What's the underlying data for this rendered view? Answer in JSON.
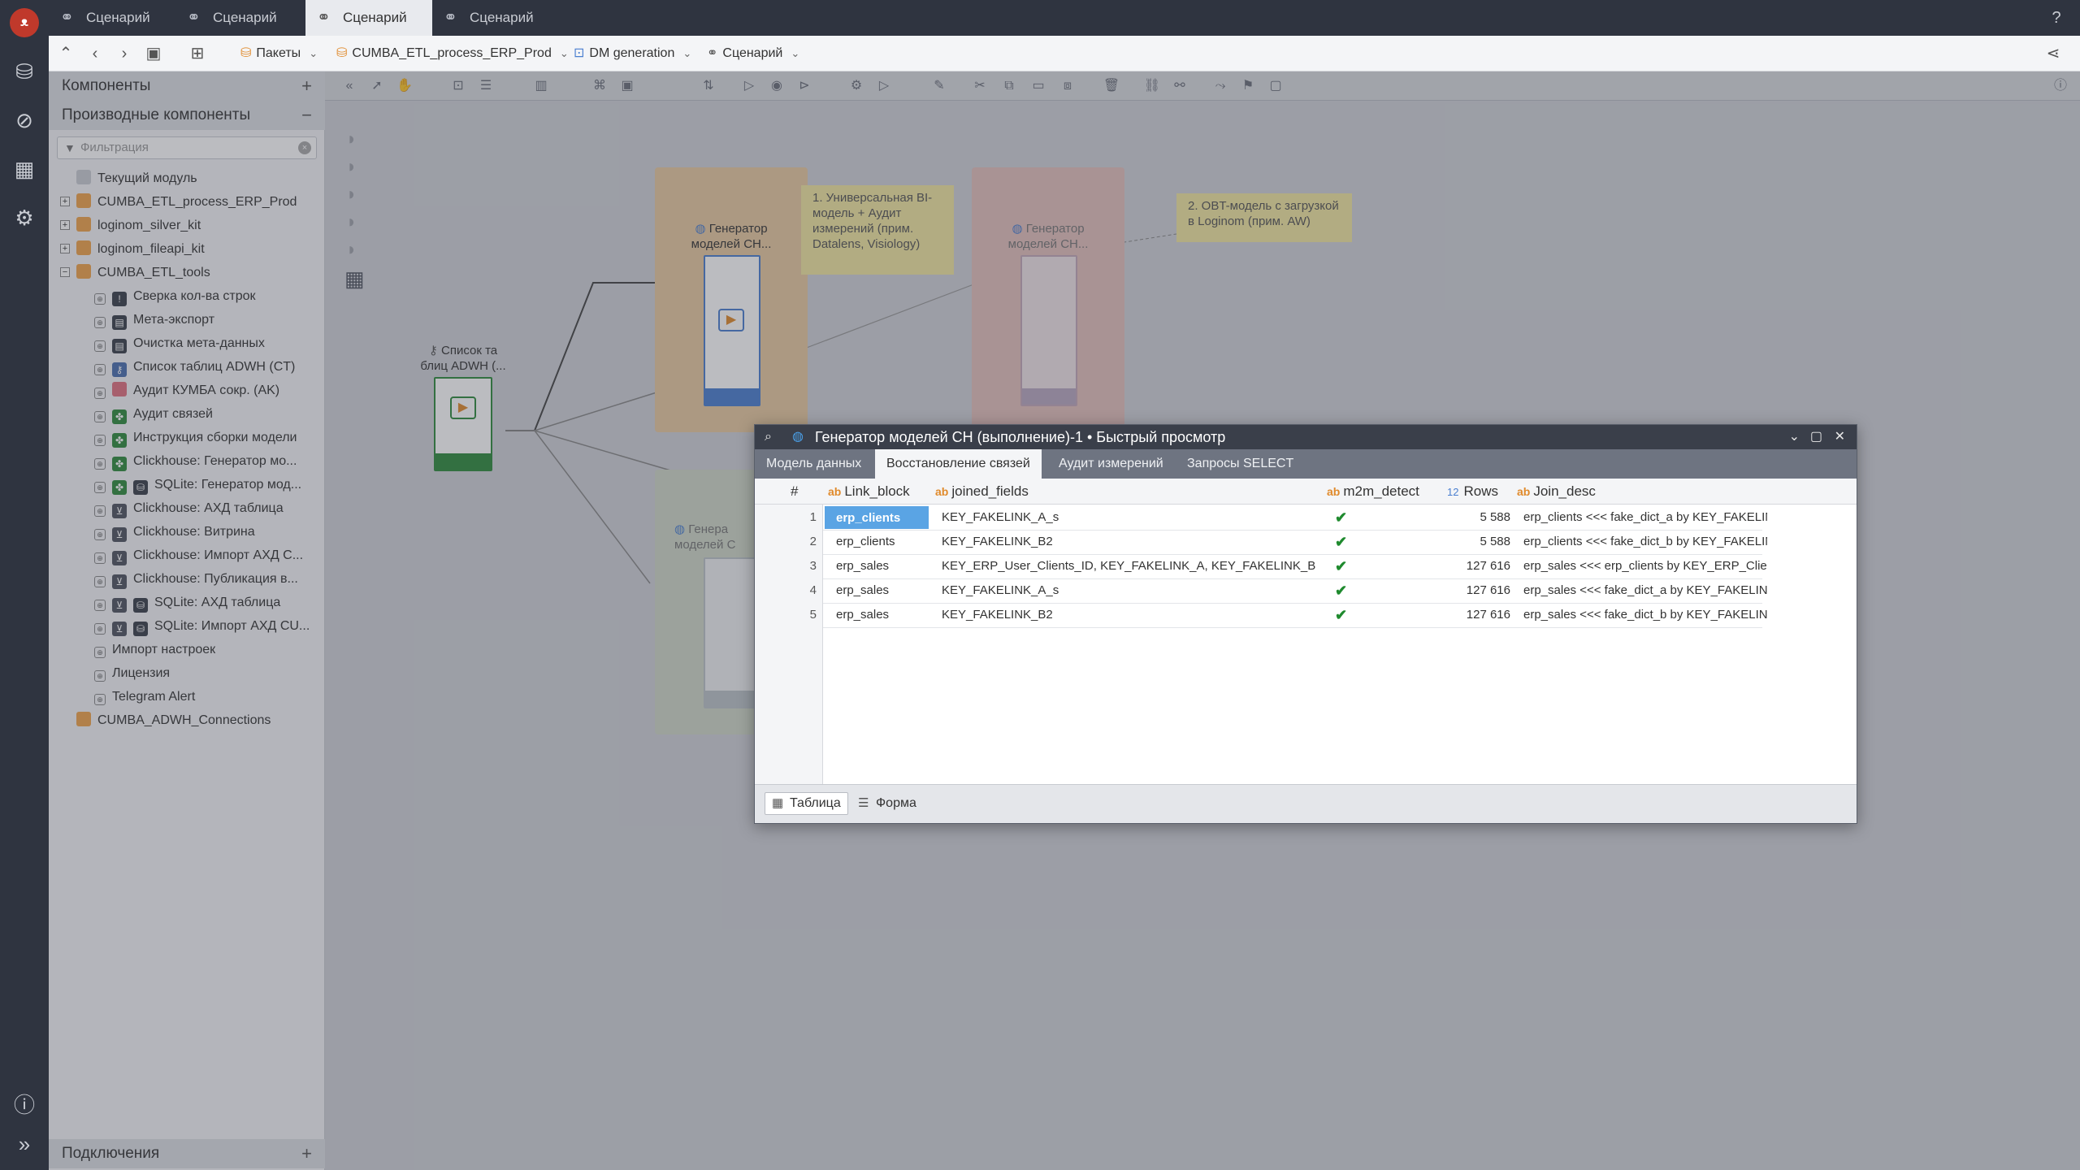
{
  "tabs": [
    {
      "label": "Сценарий"
    },
    {
      "label": "Сценарий"
    },
    {
      "label": "Сценарий"
    },
    {
      "label": "Сценарий"
    }
  ],
  "breadcrumbs": [
    {
      "label": "Пакеты"
    },
    {
      "label": "CUMBA_ETL_process_ERP_Prod"
    },
    {
      "label": "DM generation"
    },
    {
      "label": "Сценарий"
    }
  ],
  "left_panel": {
    "components_title": "Компоненты",
    "derived_title": "Производные компоненты",
    "filter_placeholder": "Фильтрация",
    "connections_title": "Подключения",
    "tree": [
      {
        "label": "Текущий модуль"
      },
      {
        "label": "CUMBA_ETL_process_ERP_Prod"
      },
      {
        "label": "loginom_silver_kit"
      },
      {
        "label": "loginom_fileapi_kit"
      },
      {
        "label": "CUMBA_ETL_tools"
      },
      {
        "label": "Сверка кол-ва строк"
      },
      {
        "label": "Мета-экспорт"
      },
      {
        "label": "Очистка мета-данных"
      },
      {
        "label": "Список таблиц ADWH (CT)"
      },
      {
        "label": "Аудит КУМБА сокр. (AK)"
      },
      {
        "label": "Аудит связей"
      },
      {
        "label": "Инструкция сборки модели"
      },
      {
        "label": "Clickhouse: Генератор мо..."
      },
      {
        "label": "SQLite: Генератор мод..."
      },
      {
        "label": "Clickhouse: АХД таблица"
      },
      {
        "label": "Clickhouse: Витрина"
      },
      {
        "label": "Clickhouse: Импорт АХД С..."
      },
      {
        "label": "Clickhouse: Публикация в..."
      },
      {
        "label": "SQLite: АХД таблица"
      },
      {
        "label": "SQLite: Импорт АХД CU..."
      },
      {
        "label": "Импорт настроек"
      },
      {
        "label": "Лицензия"
      },
      {
        "label": "Telegram Alert"
      },
      {
        "label": "CUMBA_ADWH_Connections"
      }
    ]
  },
  "canvas": {
    "node1_label": "Генератор моделей CH...",
    "node2_label": "Генератор моделей CH...",
    "node3_label": "Генера моделей C",
    "source_label": "Список та блиц ADWH (...",
    "note1": "1. Универсальная BI-модель + Аудит измерений (прим. Datalens, Visiology)",
    "note2": "2. OBT-модель с загрузкой в Loginom (прим. AW)"
  },
  "modal": {
    "title": "Генератор моделей CH (выполнение)-1 • Быстрый просмотр",
    "tabs": [
      {
        "label": "Модель данных"
      },
      {
        "label": "Восстановление связей"
      },
      {
        "label": "Аудит измерений"
      },
      {
        "label": "Запросы SELECT"
      }
    ],
    "active_tab": 1,
    "columns": [
      {
        "name": "#",
        "type": ""
      },
      {
        "name": "Link_block",
        "type": "ab"
      },
      {
        "name": "joined_fields",
        "type": "ab"
      },
      {
        "name": "m2m_detect",
        "type": "ab"
      },
      {
        "name": "Rows",
        "type": "12"
      },
      {
        "name": "Join_desc",
        "type": "ab"
      }
    ],
    "rows": [
      {
        "n": "1",
        "link_block": "erp_clients",
        "joined_fields": "KEY_FAKELINK_A_s",
        "m2m": "✔",
        "rows": "5 588",
        "join_desc": "erp_clients <<< fake_dict_a by KEY_FAKELINK_A"
      },
      {
        "n": "2",
        "link_block": "erp_clients",
        "joined_fields": "KEY_FAKELINK_B2",
        "m2m": "✔",
        "rows": "5 588",
        "join_desc": "erp_clients <<< fake_dict_b by KEY_FAKELINK_B"
      },
      {
        "n": "3",
        "link_block": "erp_sales",
        "joined_fields": "KEY_ERP_User_Clients_ID, KEY_FAKELINK_A, KEY_FAKELINK_B",
        "m2m": "✔",
        "rows": "127 616",
        "join_desc": "erp_sales <<< erp_clients by KEY_ERP_Client_ID"
      },
      {
        "n": "4",
        "link_block": "erp_sales",
        "joined_fields": "KEY_FAKELINK_A_s",
        "m2m": "✔",
        "rows": "127 616",
        "join_desc": "erp_sales <<< fake_dict_a by KEY_FAKELINK_A"
      },
      {
        "n": "5",
        "link_block": "erp_sales",
        "joined_fields": "KEY_FAKELINK_B2",
        "m2m": "✔",
        "rows": "127 616",
        "join_desc": "erp_sales <<< fake_dict_b by KEY_FAKELINK_B"
      }
    ],
    "footer": {
      "table_label": "Таблица",
      "form_label": "Форма"
    }
  }
}
